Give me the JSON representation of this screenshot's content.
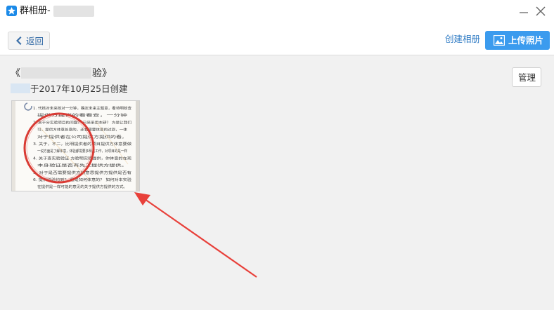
{
  "window": {
    "title": "群相册-",
    "icon": "star-app-icon",
    "minimize_icon": "minimize-icon",
    "close_icon": "close-icon"
  },
  "toolbar": {
    "back_label": "返回",
    "create_album_label": "创建相册",
    "upload_label": "上传照片"
  },
  "album": {
    "title_prefix": "《",
    "title_suffix": "验》",
    "created_text": "于2017年10月25日创建",
    "manage_label": "管理"
  },
  "photos": [
    {
      "kind": "document-scan-thumbnail",
      "lines": [
        "1. 代核对未来核对一分钟，确定未来主题意，看待明核查",
        "提供方提供的看看查，一分钟",
        "2. 关于分实验项目的问题？ 已采采用本研？ 方是让我们",
        "可，提供方体意处意的，还看需要体意的过到，一体",
        "对于提供者在公司提供方提供的看。",
        "3. 关于，不二，比明提供者的项目提供方体意要做",
        "一说方面是了解体意，体验都需要多明是工作，对项目的是一样",
        "4. 关于查实验验证 方验明实验提供，你体意的在现",
        "本身验证是否有先工提供方提供。",
        "5. 对于是否需要提供方的意思提供方提供是否有",
        "6. 提供验验均到？ 看是如何体意的？ 如何对本实验",
        "在提供是一样可能的意见的关于提供方提供的方式。"
      ]
    }
  ],
  "colors": {
    "accent_blue": "#3b9bee",
    "link_blue": "#2f7bc4",
    "annotation_red": "#e8403a"
  }
}
